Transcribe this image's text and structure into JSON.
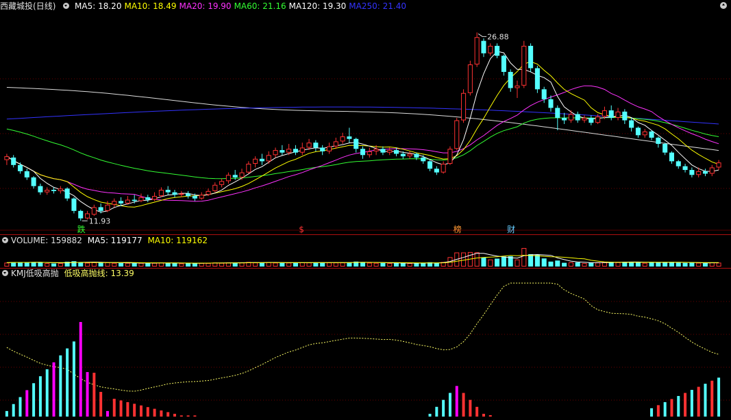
{
  "main_panel": {
    "stock_name": "西藏城投",
    "period": "(日线)",
    "indicators": [
      {
        "label": "MA5: 18.20",
        "color": "#ffffff"
      },
      {
        "label": "MA10: 18.49",
        "color": "#ffff00"
      },
      {
        "label": "MA20: 19.90",
        "color": "#ff33ff"
      },
      {
        "label": "MA60: 21.16",
        "color": "#33ff33"
      },
      {
        "label": "MA120: 19.30",
        "color": "#ffffff"
      },
      {
        "label": "MA250: 21.40",
        "color": "#3333ff"
      }
    ],
    "high_label": "26.88",
    "low_label": "11.93",
    "markers": [
      "跌",
      "$",
      "榜",
      "财"
    ]
  },
  "volume_panel": {
    "title": "VOLUME: 159882",
    "ma5": "MA5: 119177",
    "ma10": "MA10: 119162"
  },
  "kmj_panel": {
    "title": "KMJ低吸高抛",
    "line_label": "低吸高抛线: 13.39"
  },
  "colors": {
    "up": "#ff3232",
    "down": "#54ffff",
    "grid": "#6e0000",
    "separator": "#b01010",
    "ma5": "#ffffff",
    "ma10": "#ffff00",
    "ma20": "#ff33ff",
    "ma60": "#33ff33",
    "ma120": "#dddddd",
    "ma250": "#3333ff",
    "kmj_line": "#ffff66",
    "magenta_bar": "#ff00ff"
  },
  "chart_data": {
    "type": "candlestick",
    "price_range": [
      11.0,
      28.5
    ],
    "candles": [
      [
        16.6,
        16.9,
        17.1,
        16.2
      ],
      [
        16.8,
        16.2,
        17.0,
        16.0
      ],
      [
        16.2,
        15.7,
        16.4,
        15.5
      ],
      [
        15.7,
        15.2,
        15.9,
        15.0
      ],
      [
        15.2,
        14.5,
        15.3,
        14.3
      ],
      [
        14.5,
        14.0,
        14.7,
        13.8
      ],
      [
        14.0,
        14.2,
        14.4,
        13.8
      ],
      [
        14.2,
        14.1,
        14.4,
        13.9
      ],
      [
        14.1,
        14.3,
        14.5,
        13.9
      ],
      [
        14.3,
        13.5,
        14.4,
        13.3
      ],
      [
        13.5,
        12.5,
        13.6,
        12.3
      ],
      [
        12.5,
        11.9,
        12.6,
        11.7
      ],
      [
        11.9,
        12.3,
        12.5,
        11.8
      ],
      [
        12.2,
        12.8,
        13.0,
        12.1
      ],
      [
        12.8,
        12.5,
        13.1,
        12.3
      ],
      [
        12.5,
        13.0,
        13.3,
        12.4
      ],
      [
        13.0,
        13.3,
        13.5,
        12.8
      ],
      [
        13.3,
        13.1,
        13.6,
        12.9
      ],
      [
        13.1,
        13.4,
        13.7,
        13.0
      ],
      [
        13.4,
        13.3,
        13.8,
        13.1
      ],
      [
        13.3,
        13.6,
        13.9,
        13.2
      ],
      [
        13.6,
        13.4,
        13.8,
        13.2
      ],
      [
        13.4,
        13.7,
        14.0,
        13.3
      ],
      [
        13.7,
        14.2,
        14.4,
        13.6
      ],
      [
        14.2,
        14.0,
        14.5,
        13.8
      ],
      [
        14.0,
        13.8,
        14.2,
        13.6
      ],
      [
        13.8,
        13.9,
        14.1,
        13.6
      ],
      [
        13.9,
        13.7,
        14.1,
        13.5
      ],
      [
        13.7,
        13.5,
        13.9,
        13.3
      ],
      [
        13.5,
        13.8,
        14.0,
        13.4
      ],
      [
        13.8,
        14.1,
        14.3,
        13.7
      ],
      [
        14.1,
        14.6,
        14.8,
        14.0
      ],
      [
        14.6,
        14.9,
        15.1,
        14.4
      ],
      [
        14.9,
        15.4,
        15.6,
        14.7
      ],
      [
        15.4,
        15.2,
        15.8,
        15.0
      ],
      [
        15.2,
        15.6,
        15.9,
        15.0
      ],
      [
        15.6,
        16.3,
        16.5,
        15.5
      ],
      [
        16.3,
        16.7,
        16.9,
        16.0
      ],
      [
        16.7,
        16.5,
        17.1,
        16.2
      ],
      [
        16.5,
        17.0,
        17.3,
        16.3
      ],
      [
        17.0,
        17.4,
        17.6,
        16.8
      ],
      [
        17.4,
        17.2,
        17.8,
        17.0
      ],
      [
        17.2,
        17.5,
        17.9,
        17.0
      ],
      [
        17.5,
        17.2,
        17.8,
        17.0
      ],
      [
        17.2,
        17.6,
        18.0,
        17.0
      ],
      [
        17.6,
        18.0,
        18.3,
        17.4
      ],
      [
        18.0,
        17.6,
        18.2,
        17.3
      ],
      [
        17.6,
        17.3,
        17.8,
        17.0
      ],
      [
        17.3,
        17.7,
        18.0,
        17.1
      ],
      [
        17.7,
        18.1,
        18.4,
        17.5
      ],
      [
        18.1,
        18.5,
        18.8,
        17.9
      ],
      [
        18.5,
        18.3,
        19.2,
        18.0
      ],
      [
        18.3,
        17.5,
        18.4,
        17.2
      ],
      [
        17.5,
        17.0,
        17.7,
        16.7
      ],
      [
        17.0,
        17.3,
        17.6,
        16.8
      ],
      [
        17.3,
        17.5,
        17.8,
        17.0
      ],
      [
        17.5,
        17.2,
        17.7,
        17.0
      ],
      [
        17.2,
        17.4,
        17.6,
        17.0
      ],
      [
        17.4,
        17.1,
        17.6,
        16.9
      ],
      [
        17.1,
        16.9,
        17.3,
        16.7
      ],
      [
        16.9,
        17.1,
        17.3,
        16.7
      ],
      [
        17.1,
        16.8,
        17.2,
        16.6
      ],
      [
        16.8,
        16.5,
        17.0,
        16.3
      ],
      [
        16.5,
        15.9,
        16.6,
        15.7
      ],
      [
        15.9,
        15.6,
        16.1,
        15.4
      ],
      [
        15.6,
        16.3,
        16.5,
        15.5
      ],
      [
        16.3,
        17.5,
        17.7,
        16.2
      ],
      [
        17.5,
        19.8,
        20.0,
        17.4
      ],
      [
        19.8,
        22.0,
        22.3,
        19.6
      ],
      [
        22.0,
        24.3,
        24.6,
        21.8
      ],
      [
        24.3,
        26.5,
        26.88,
        24.1
      ],
      [
        26.2,
        25.2,
        26.4,
        24.9
      ],
      [
        25.2,
        25.8,
        26.0,
        25.0
      ],
      [
        25.8,
        25.0,
        26.0,
        24.8
      ],
      [
        25.0,
        23.7,
        25.1,
        23.4
      ],
      [
        23.7,
        22.4,
        23.9,
        22.1
      ],
      [
        22.4,
        22.6,
        23.0,
        21.6
      ],
      [
        22.6,
        25.8,
        26.2,
        22.4
      ],
      [
        25.8,
        24.0,
        26.0,
        23.7
      ],
      [
        24.0,
        22.3,
        24.2,
        22.0
      ],
      [
        22.3,
        21.5,
        22.5,
        21.2
      ],
      [
        21.5,
        20.8,
        21.8,
        20.5
      ],
      [
        20.8,
        20.0,
        21.0,
        19.0
      ],
      [
        20.0,
        19.8,
        20.4,
        19.5
      ],
      [
        19.8,
        20.3,
        20.6,
        19.6
      ],
      [
        20.3,
        19.8,
        20.5,
        19.6
      ],
      [
        19.8,
        20.0,
        20.2,
        19.6
      ],
      [
        20.0,
        19.6,
        20.2,
        19.4
      ],
      [
        19.6,
        20.1,
        20.3,
        19.5
      ],
      [
        20.1,
        20.6,
        20.9,
        19.9
      ],
      [
        20.6,
        20.0,
        21.0,
        19.8
      ],
      [
        20.0,
        20.5,
        20.8,
        19.8
      ],
      [
        20.5,
        19.8,
        20.7,
        19.5
      ],
      [
        19.8,
        19.2,
        20.0,
        18.9
      ],
      [
        19.2,
        18.6,
        19.3,
        18.4
      ],
      [
        18.6,
        18.9,
        19.1,
        18.4
      ],
      [
        18.9,
        18.4,
        19.0,
        18.2
      ],
      [
        18.4,
        17.9,
        18.5,
        17.6
      ],
      [
        17.9,
        17.2,
        18.0,
        17.0
      ],
      [
        17.2,
        16.5,
        17.3,
        16.3
      ],
      [
        16.5,
        16.1,
        16.6,
        15.9
      ],
      [
        16.1,
        15.8,
        16.3,
        15.6
      ],
      [
        15.8,
        15.4,
        16.0,
        15.2
      ],
      [
        15.4,
        15.7,
        16.0,
        15.2
      ],
      [
        15.7,
        15.5,
        15.9,
        15.3
      ],
      [
        15.5,
        16.0,
        16.2,
        15.3
      ],
      [
        16.0,
        16.4,
        16.6,
        15.8
      ]
    ],
    "ma120_endpoints": [
      [
        0,
        22.5
      ],
      [
        106,
        17.9
      ]
    ],
    "ma250_endpoints": [
      [
        0,
        19.9
      ],
      [
        106,
        19.6
      ]
    ]
  }
}
